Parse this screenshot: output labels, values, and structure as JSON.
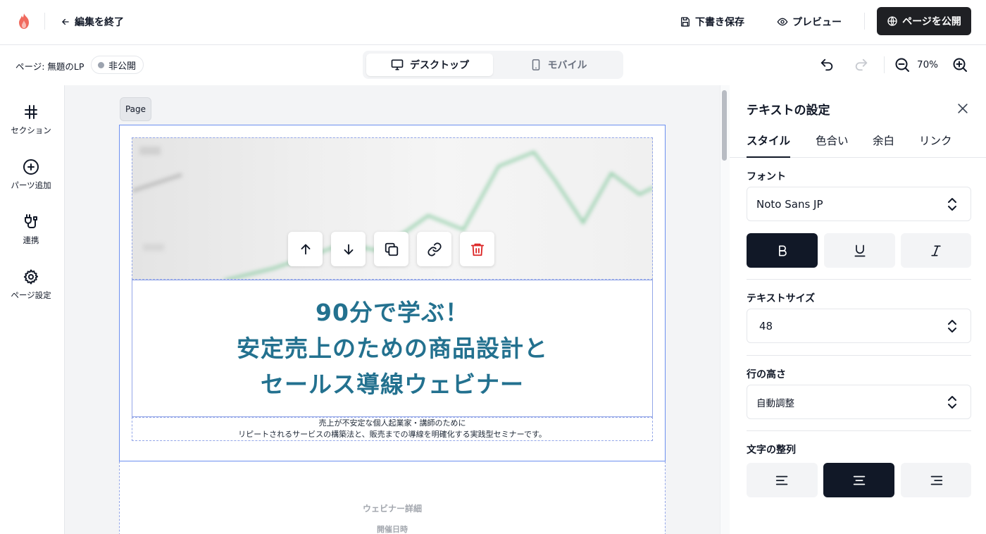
{
  "topbar": {
    "back_label": "編集を終了",
    "save_draft_label": "下書き保存",
    "preview_label": "プレビュー",
    "publish_label": "ページを公開"
  },
  "subbar": {
    "page_name": "ページ: 無題のLP",
    "status": "非公開",
    "device_desktop": "デスクトップ",
    "device_mobile": "モバイル",
    "zoom": "70%"
  },
  "sidebar": {
    "items": [
      {
        "label": "セクション",
        "icon": "hash-icon"
      },
      {
        "label": "パーツ追加",
        "icon": "plus-circle-icon"
      },
      {
        "label": "連携",
        "icon": "plug-icon"
      },
      {
        "label": "ページ設定",
        "icon": "gear-icon"
      }
    ]
  },
  "canvas": {
    "page_tag": "Page",
    "headline": [
      "90分で学ぶ！",
      "安定売上のための商品設計と",
      "セールス導線ウェビナー"
    ],
    "subtext": [
      "売上が不安定な個人起業家・講師のために",
      "リピートされるサービスの構築法と、販売までの導線を明確化する実践型セミナーです。"
    ],
    "section_title": "ウェビナー詳細",
    "section_sub": "開催日時"
  },
  "panel": {
    "title": "テキストの設定",
    "tabs": [
      "スタイル",
      "色合い",
      "余白",
      "リンク"
    ],
    "font_label": "フォント",
    "font_value": "Noto Sans JP",
    "size_label": "テキストサイズ",
    "size_value": "48",
    "line_height_label": "行の高さ",
    "line_height_value": "自動調整",
    "align_label": "文字の整列"
  },
  "colors": {
    "accent": "#111827",
    "headline": "#23718f",
    "selection": "#6b8ff0",
    "delete": "#dc2626",
    "logo": "#f06a5e"
  }
}
